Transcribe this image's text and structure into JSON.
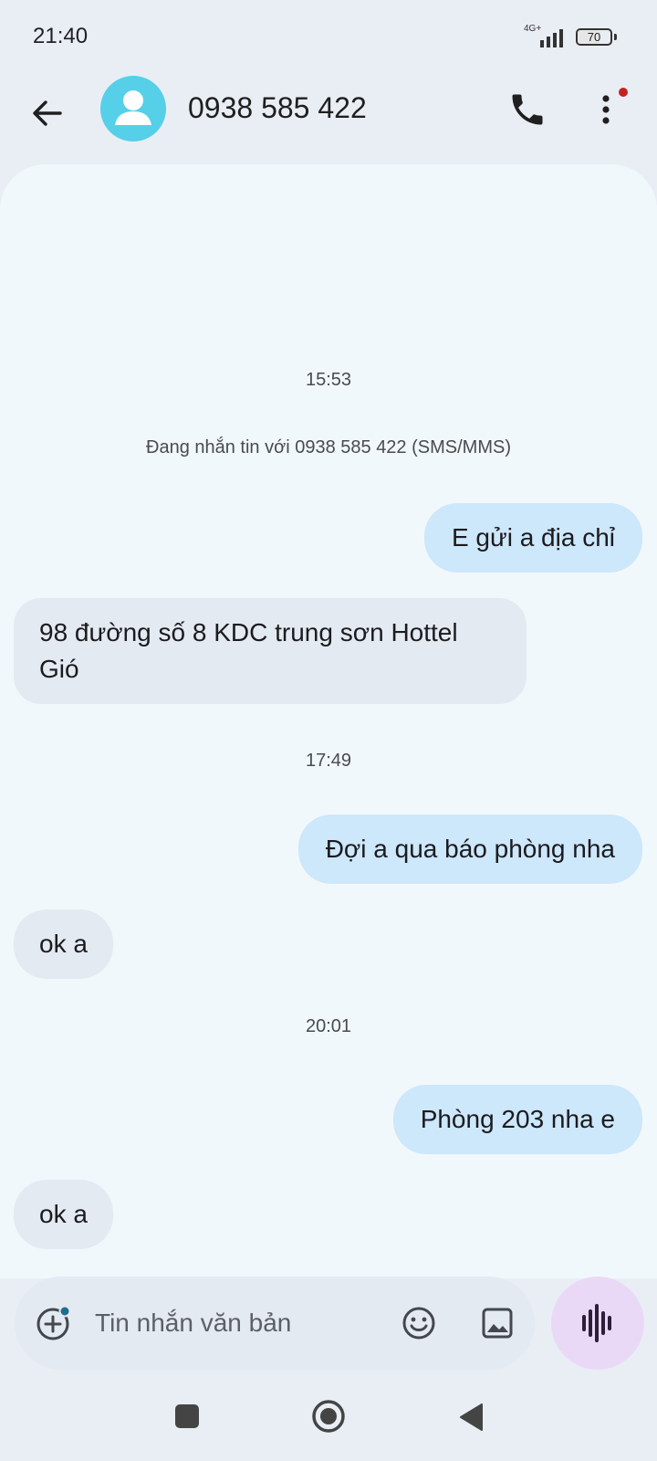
{
  "status_bar": {
    "time": "21:40",
    "network": "4G+",
    "battery": "70",
    "battery_level_percent": 70
  },
  "app_bar": {
    "contact": "0938 585 422",
    "icons": [
      "back-arrow-icon",
      "contact-avatar-icon",
      "phone-icon",
      "more-vert-icon"
    ]
  },
  "conversation": {
    "info_text": "Đang nhắn tin với 0938 585 422 (SMS/MMS)",
    "timestamps": [
      "15:53",
      "17:49",
      "20:01"
    ],
    "messages": [
      {
        "direction": "outgoing",
        "text": "E gửi a địa chỉ"
      },
      {
        "direction": "incoming",
        "text": " 98 đường số 8 KDC trung sơn Hottel\nGió"
      },
      {
        "direction": "outgoing",
        "text": "Đợi a qua báo phòng nha"
      },
      {
        "direction": "incoming",
        "text": "ok a"
      },
      {
        "direction": "outgoing",
        "text": "Phòng 203 nha e"
      },
      {
        "direction": "incoming",
        "text": "ok a"
      }
    ]
  },
  "composer": {
    "placeholder": "Tin nhắn văn bản",
    "icons": [
      "add-icon",
      "emoji-icon",
      "gallery-icon",
      "voice-wave-icon"
    ]
  },
  "colors": {
    "outgoing_bubble": "#cde7fb",
    "incoming_bubble": "#e4eaf1",
    "chat_background": "#f1f8fc",
    "avatar": "#55d0e8",
    "voice_button": "#ead9f6",
    "notification_dot": "#c5221f"
  },
  "navigation_icons": [
    "recents-icon",
    "home-icon",
    "nav-back-icon"
  ]
}
